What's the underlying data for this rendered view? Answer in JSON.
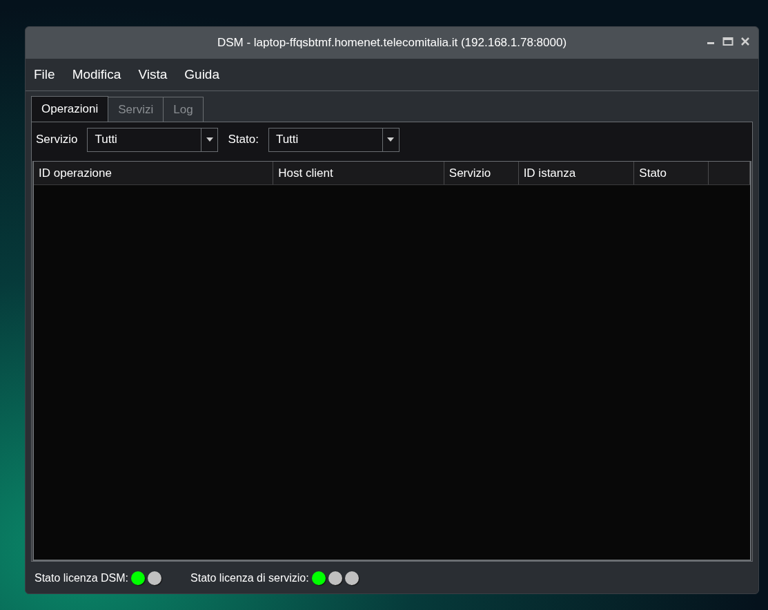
{
  "window": {
    "title": "DSM - laptop-ffqsbtmf.homenet.telecomitalia.it (192.168.1.78:8000)"
  },
  "menu": [
    "File",
    "Modifica",
    "Vista",
    "Guida"
  ],
  "tabs": [
    {
      "label": "Operazioni",
      "selected": true
    },
    {
      "label": "Servizi",
      "selected": false
    },
    {
      "label": "Log",
      "selected": false
    }
  ],
  "filters": [
    {
      "label": "Servizio",
      "value": "Tutti"
    },
    {
      "label": "Stato:",
      "value": "Tutti"
    }
  ],
  "table": {
    "columns": [
      "ID operazione",
      "Host client",
      "Servizio",
      "ID istanza",
      "Stato"
    ]
  },
  "status_bar": [
    {
      "label": "Stato licenza DSM:",
      "lights": [
        {
          "color": "#00ff00"
        },
        {
          "color": "#c0c0c0"
        }
      ]
    },
    {
      "label": "Stato licenza di servizio:",
      "lights": [
        {
          "color": "#00ff00"
        },
        {
          "color": "#c0c0c0"
        },
        {
          "color": "#c0c0c0"
        }
      ]
    }
  ]
}
